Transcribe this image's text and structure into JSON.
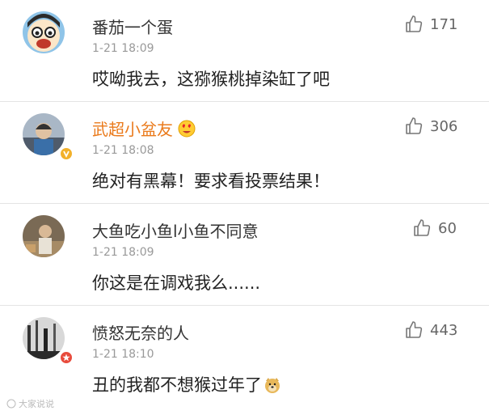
{
  "comments": [
    {
      "username": "番茄一个蛋",
      "time": "1-21 18:09",
      "text": "哎呦我去，这猕猴桃掉染缸了吧",
      "likes": "171"
    },
    {
      "username": "武超小盆友",
      "time": "1-21 18:08",
      "text": "绝对有黑幕！要求看投票结果！",
      "likes": "306"
    },
    {
      "username": "大鱼吃小鱼l小鱼不同意",
      "time": "1-21 18:09",
      "text": "你这是在调戏我么......",
      "likes": "60"
    },
    {
      "username": "愤怒无奈的人",
      "time": "1-21 18:10",
      "text": "丑的我都不想猴过年了",
      "likes": "443"
    }
  ],
  "watermark": "大家说说",
  "colors": {
    "vip_name": "#ea7a1b",
    "name": "#333333",
    "time": "#999999",
    "divider": "#e4e4e4"
  },
  "icons": [
    "thumbs-up-icon",
    "heart-eyes-emoji-icon",
    "doge-emoji-icon",
    "verified-badge-icon",
    "vip-badge-icon"
  ]
}
